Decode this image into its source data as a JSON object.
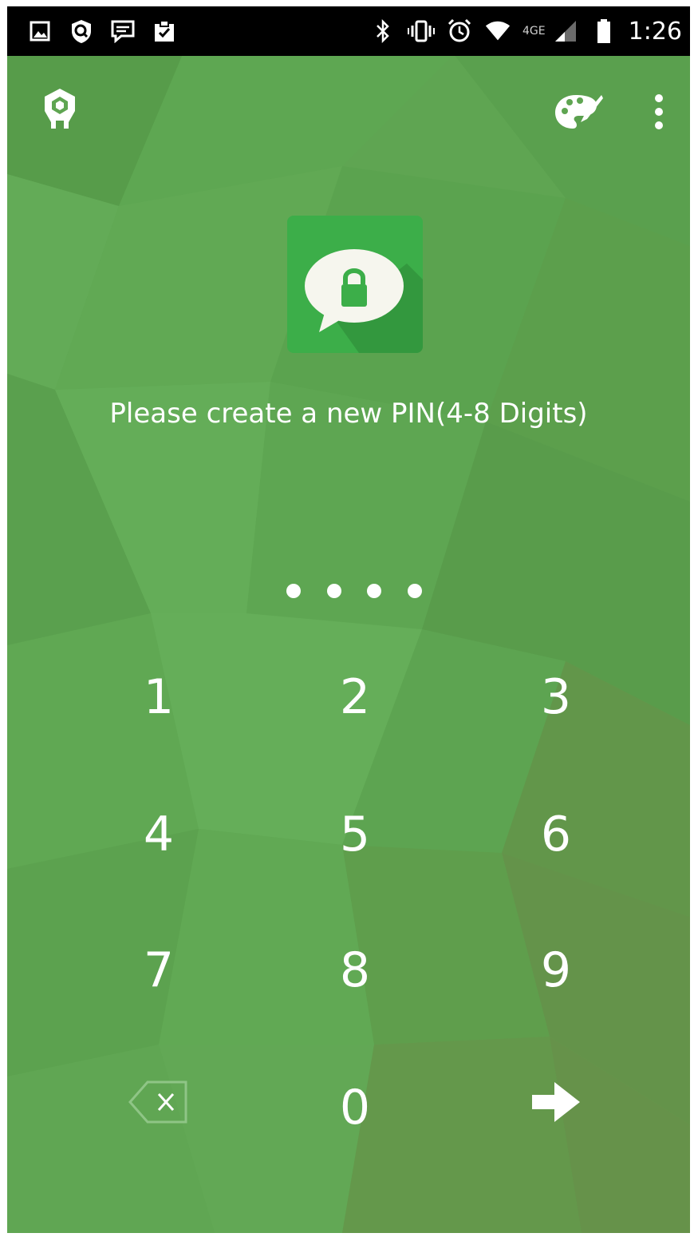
{
  "status_bar": {
    "left_icons": [
      "gallery-icon",
      "shield-search-icon",
      "message-icon",
      "clipboard-check-icon"
    ],
    "right_icons": [
      "bluetooth-icon",
      "vibrate-icon",
      "alarm-icon",
      "wifi-icon",
      "signal-icon",
      "battery-icon"
    ],
    "network": "4GE",
    "time": "1:26"
  },
  "toolbar": {
    "left_icon": "app-logo-icon",
    "theme_icon": "palette-icon",
    "menu_icon": "more-vert-icon"
  },
  "lock": {
    "app_icon": "message-lock-icon",
    "prompt": "Please create a new PIN(4-8 Digits)",
    "entered_count": 4
  },
  "keypad": {
    "keys": [
      "1",
      "2",
      "3",
      "4",
      "5",
      "6",
      "7",
      "8",
      "9"
    ],
    "zero": "0",
    "delete_icon": "backspace-icon",
    "next_icon": "arrow-right-icon"
  },
  "colors": {
    "background": "#5fa552",
    "status_bar": "#000000",
    "icon_green": "#3cae49",
    "text": "#ffffff"
  }
}
